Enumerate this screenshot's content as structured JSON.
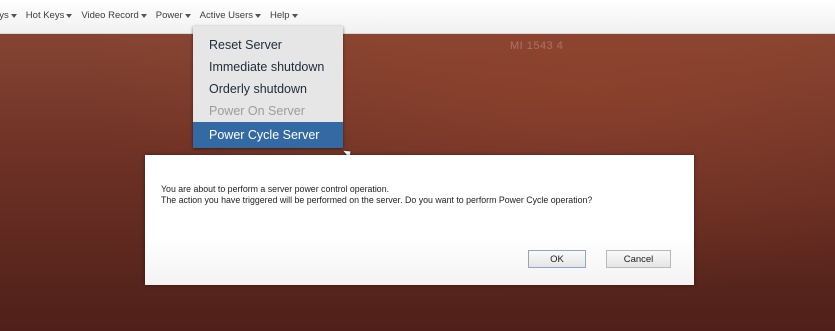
{
  "menubar": {
    "items": [
      {
        "label": "eys"
      },
      {
        "label": "Hot Keys"
      },
      {
        "label": "Video Record"
      },
      {
        "label": "Power"
      },
      {
        "label": "Active Users"
      },
      {
        "label": "Help"
      }
    ]
  },
  "desktop": {
    "label": "MI 1543 4"
  },
  "power_menu": {
    "options": [
      {
        "label": "Reset Server",
        "state": "enabled"
      },
      {
        "label": "Immediate shutdown",
        "state": "enabled"
      },
      {
        "label": "Orderly shutdown",
        "state": "enabled"
      },
      {
        "label": "Power On Server",
        "state": "disabled"
      },
      {
        "label": "Power Cycle Server",
        "state": "selected"
      }
    ]
  },
  "dialog": {
    "line1": "You are about to perform a server power control operation.",
    "line2": "The action you have triggered will be performed on the server. Do you want to perform Power Cycle operation?",
    "ok_label": "OK",
    "cancel_label": "Cancel"
  },
  "colors": {
    "selection": "#346aa3",
    "disabled_text": "#9c9c9c",
    "desktop_top": "#8d4a36",
    "desktop_bottom": "#4f2019"
  }
}
